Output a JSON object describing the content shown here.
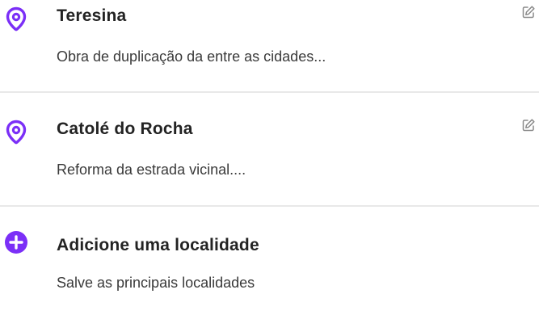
{
  "accent_color": "#7b2ff7",
  "locations": [
    {
      "title": "Teresina",
      "subtitle": "Obra de duplicação da entre as cidades...",
      "icon": "map-pin-icon",
      "action_icon": "edit-icon"
    },
    {
      "title": "Catolé do Rocha",
      "subtitle": "Reforma da estrada vicinal....",
      "icon": "map-pin-icon",
      "action_icon": "edit-icon"
    }
  ],
  "add_location": {
    "title": "Adicione uma localidade",
    "subtitle": "Salve as principais localidades",
    "icon": "plus-circle-icon"
  }
}
